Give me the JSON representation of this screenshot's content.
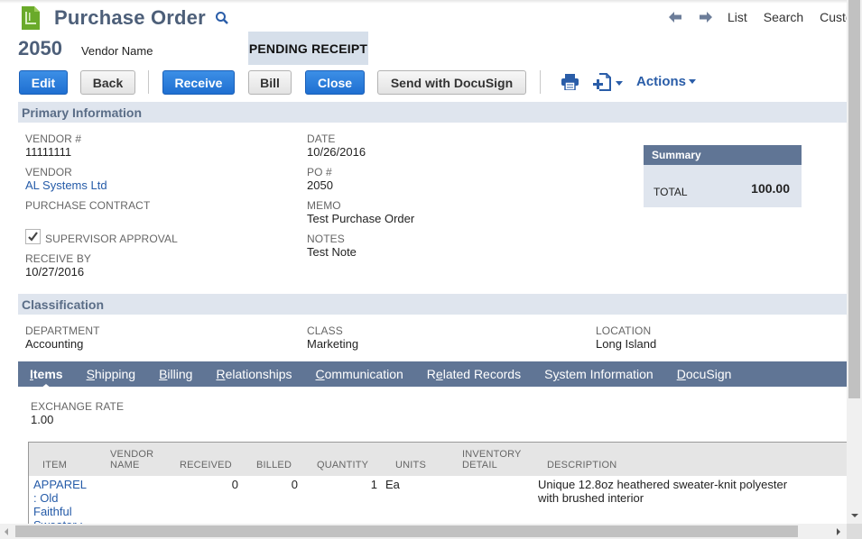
{
  "header": {
    "title": "Purchase Order",
    "record_number": "2050",
    "vendor_name_label": "Vendor Name",
    "status": "PENDING RECEIPT",
    "nav_links": [
      "List",
      "Search",
      "Custo"
    ]
  },
  "toolbar": {
    "edit": "Edit",
    "back": "Back",
    "receive": "Receive",
    "bill": "Bill",
    "close": "Close",
    "docusign": "Send with DocuSign",
    "actions": "Actions"
  },
  "primary": {
    "section_title": "Primary Information",
    "vendor_num_label": "VENDOR #",
    "vendor_num": "11111111",
    "vendor_label": "VENDOR",
    "vendor": "AL Systems Ltd",
    "contract_label": "PURCHASE CONTRACT",
    "supervisor_label": "SUPERVISOR APPROVAL",
    "supervisor_checked": true,
    "receive_by_label": "RECEIVE BY",
    "receive_by": "10/27/2016",
    "date_label": "DATE",
    "date": "10/26/2016",
    "po_label": "PO #",
    "po": "2050",
    "memo_label": "MEMO",
    "memo": "Test Purchase Order",
    "notes_label": "NOTES",
    "notes": "Test Note"
  },
  "summary": {
    "title": "Summary",
    "total_label": "TOTAL",
    "total": "100.00"
  },
  "classification": {
    "section_title": "Classification",
    "department_label": "DEPARTMENT",
    "department": "Accounting",
    "class_label": "CLASS",
    "class": "Marketing",
    "location_label": "LOCATION",
    "location": "Long Island"
  },
  "tabs": [
    {
      "u": "I",
      "rest": "tems",
      "pre": "",
      "active": true
    },
    {
      "u": "S",
      "rest": "hipping",
      "pre": ""
    },
    {
      "u": "B",
      "rest": "illing",
      "pre": ""
    },
    {
      "u": "R",
      "rest": "elationships",
      "pre": ""
    },
    {
      "u": "C",
      "rest": "ommunication",
      "pre": ""
    },
    {
      "pre": "R",
      "u": "e",
      "rest": "lated Records"
    },
    {
      "pre": "S",
      "u": "y",
      "rest": "stem Information"
    },
    {
      "u": "D",
      "rest": "ocuSign",
      "pre": ""
    }
  ],
  "items": {
    "exchange_rate_label": "EXCHANGE RATE",
    "exchange_rate": "1.00",
    "columns": {
      "item": "ITEM",
      "vendor_name_1": "VENDOR",
      "vendor_name_2": "NAME",
      "received": "RECEIVED",
      "billed": "BILLED",
      "quantity": "QUANTITY",
      "units": "UNITS",
      "inventory_1": "INVENTORY",
      "inventory_2": "DETAIL",
      "description": "DESCRIPTION"
    },
    "rows": [
      {
        "item_lines": [
          "APPAREL",
          ": Old",
          "Faithful",
          "Sweater :"
        ],
        "vendor_name": "",
        "received": "0",
        "billed": "0",
        "quantity": "1",
        "units": "Ea",
        "inventory_detail": "",
        "description_lines": [
          "Unique 12.8oz heathered sweater-knit polyester",
          "with brushed interior"
        ]
      }
    ]
  }
}
